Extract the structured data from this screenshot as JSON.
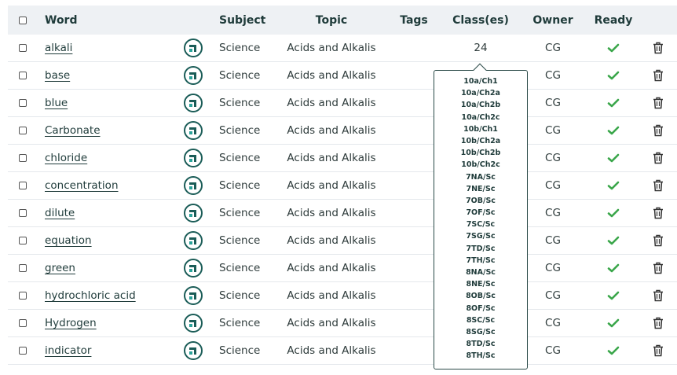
{
  "columns": {
    "word": "Word",
    "subject": "Subject",
    "topic": "Topic",
    "tags": "Tags",
    "classes": "Class(es)",
    "owner": "Owner",
    "ready": "Ready"
  },
  "colors": {
    "accent": "#1a5c57",
    "ready_check": "#3aa64a",
    "header_bg": "#eef1f4"
  },
  "icons": {
    "row_icon": "app-logo-icon",
    "ready": "check-icon",
    "delete": "trash-icon"
  },
  "rows": [
    {
      "word": "alkali",
      "subject": "Science",
      "topic": "Acids and Alkalis",
      "classes": "24",
      "owner": "CG"
    },
    {
      "word": "base",
      "subject": "Science",
      "topic": "Acids and Alkalis",
      "classes": "",
      "owner": "CG"
    },
    {
      "word": "blue",
      "subject": "Science",
      "topic": "Acids and Alkalis",
      "classes": "",
      "owner": "CG"
    },
    {
      "word": "Carbonate",
      "subject": "Science",
      "topic": "Acids and Alkalis",
      "classes": "",
      "owner": "CG"
    },
    {
      "word": "chloride",
      "subject": "Science",
      "topic": "Acids and Alkalis",
      "classes": "",
      "owner": "CG"
    },
    {
      "word": "concentration",
      "subject": "Science",
      "topic": "Acids and Alkalis",
      "classes": "",
      "owner": "CG"
    },
    {
      "word": "dilute",
      "subject": "Science",
      "topic": "Acids and Alkalis",
      "classes": "",
      "owner": "CG"
    },
    {
      "word": "equation",
      "subject": "Science",
      "topic": "Acids and Alkalis",
      "classes": "",
      "owner": "CG"
    },
    {
      "word": "green",
      "subject": "Science",
      "topic": "Acids and Alkalis",
      "classes": "",
      "owner": "CG"
    },
    {
      "word": "hydrochloric acid",
      "subject": "Science",
      "topic": "Acids and Alkalis",
      "classes": "",
      "owner": "CG"
    },
    {
      "word": "Hydrogen",
      "subject": "Science",
      "topic": "Acids and Alkalis",
      "classes": "",
      "owner": "CG"
    },
    {
      "word": "indicator",
      "subject": "Science",
      "topic": "Acids and Alkalis",
      "classes": "",
      "owner": "CG"
    }
  ],
  "classes_popup": [
    "10a/Ch1",
    "10a/Ch2a",
    "10a/Ch2b",
    "10a/Ch2c",
    "10b/Ch1",
    "10b/Ch2a",
    "10b/Ch2b",
    "10b/Ch2c",
    "7NA/Sc",
    "7NE/Sc",
    "7OB/Sc",
    "7OF/Sc",
    "7SC/Sc",
    "7SG/Sc",
    "7TD/Sc",
    "7TH/Sc",
    "8NA/Sc",
    "8NE/Sc",
    "8OB/Sc",
    "8OF/Sc",
    "8SC/Sc",
    "8SG/Sc",
    "8TD/Sc",
    "8TH/Sc"
  ]
}
